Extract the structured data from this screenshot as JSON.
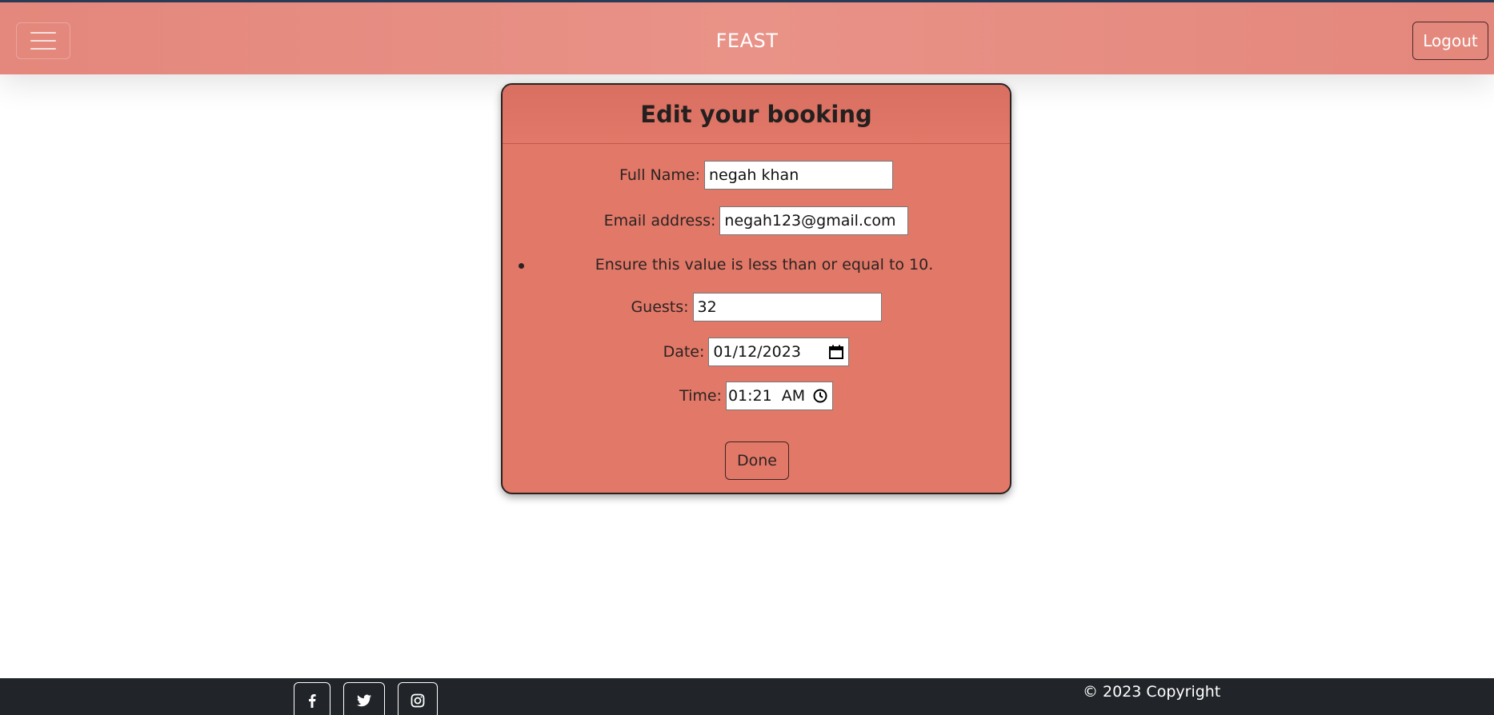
{
  "navbar": {
    "brand": "FEAST",
    "logout_label": "Logout"
  },
  "form": {
    "title": "Edit your booking",
    "full_name_label": "Full Name:",
    "full_name_value": "negah khan",
    "email_label": "Email address:",
    "email_value": "negah123@gmail.com",
    "error_message": "Ensure this value is less than or equal to 10.",
    "guests_label": "Guests:",
    "guests_value": "32",
    "date_label": "Date:",
    "date_value": "01/12/2023",
    "time_label": "Time:",
    "time_value": "01:21  AM",
    "done_label": "Done"
  },
  "footer": {
    "social_icons": [
      "facebook-icon",
      "twitter-icon",
      "instagram-icon"
    ],
    "copyright": "© 2023 Copyright"
  },
  "colors": {
    "navbar": "#e99287",
    "card": "#e27868",
    "footer": "#212529"
  }
}
